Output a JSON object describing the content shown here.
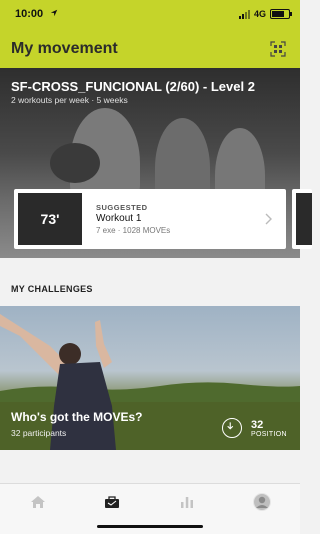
{
  "status": {
    "time": "10:00",
    "network": "4G"
  },
  "header": {
    "title": "My movement"
  },
  "program": {
    "title": "SF-CROSS_FUNCIONAL (2/60) - Level 2",
    "subtitle": "2 workouts per week · 5 weeks"
  },
  "workout_card": {
    "duration": "73'",
    "tag": "SUGGESTED",
    "name": "Workout 1",
    "meta": "7 exe · 1028 MOVEs"
  },
  "challenges": {
    "section_title": "MY CHALLENGES",
    "items": [
      {
        "title": "Who's got the MOVEs?",
        "participants": "32 participants",
        "position_value": "32",
        "position_label": "POSITION"
      }
    ]
  },
  "tabs": [
    {
      "icon": "home-icon"
    },
    {
      "icon": "briefcase-icon",
      "active": true
    },
    {
      "icon": "bar-chart-icon"
    },
    {
      "icon": "avatar-icon"
    }
  ],
  "colors": {
    "accent": "#c5d42a",
    "tab_inactive": "#c4c4c4",
    "tab_active": "#222222"
  }
}
